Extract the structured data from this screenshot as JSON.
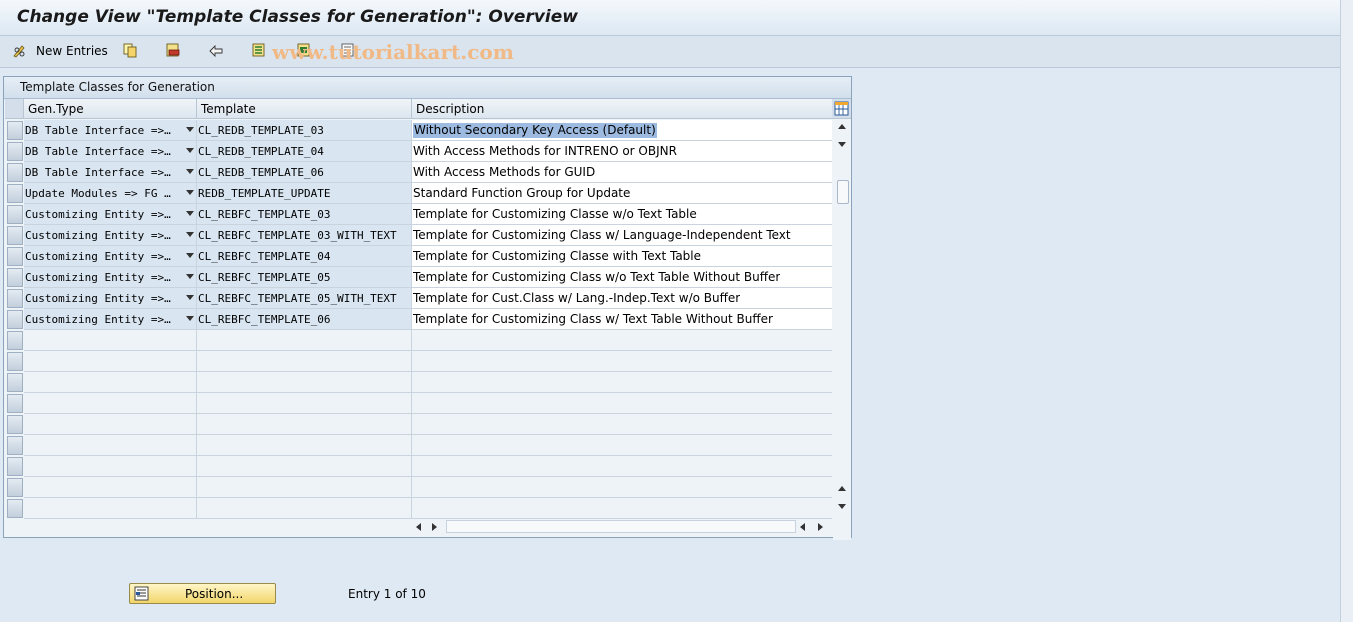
{
  "window": {
    "title": "Change View \"Template Classes for Generation\": Overview"
  },
  "toolbar": {
    "new_entries_label": "New Entries",
    "icons": [
      "pencil-glasses-icon",
      "copy-icon",
      "delete-icon",
      "undo-icon",
      "select-all-icon",
      "select-block-icon",
      "deselect-all-icon"
    ]
  },
  "watermark": "www.tutorialkart.com",
  "table": {
    "title": "Template Classes for Generation",
    "columns": [
      "Gen.Type",
      "Template",
      "Description"
    ],
    "rows": [
      {
        "gen_type": "DB Table Interface =>…",
        "template": "CL_REDB_TEMPLATE_03",
        "description": "Without Secondary Key Access (Default)"
      },
      {
        "gen_type": "DB Table Interface =>…",
        "template": "CL_REDB_TEMPLATE_04",
        "description": "With Access Methods for INTRENO or OBJNR"
      },
      {
        "gen_type": "DB Table Interface =>…",
        "template": "CL_REDB_TEMPLATE_06",
        "description": "With Access Methods for GUID"
      },
      {
        "gen_type": "Update Modules => FG …",
        "template": "REDB_TEMPLATE_UPDATE",
        "description": "Standard Function Group for Update"
      },
      {
        "gen_type": "Customizing Entity =>…",
        "template": "CL_REBFC_TEMPLATE_03",
        "description": "Template for Customizing Classe w/o Text Table"
      },
      {
        "gen_type": "Customizing Entity =>…",
        "template": "CL_REBFC_TEMPLATE_03_WITH_TEXT",
        "description": "Template for Customizing Class w/ Language-Independent Text"
      },
      {
        "gen_type": "Customizing Entity =>…",
        "template": "CL_REBFC_TEMPLATE_04",
        "description": "Template for Customizing Classe with Text Table"
      },
      {
        "gen_type": "Customizing Entity =>…",
        "template": "CL_REBFC_TEMPLATE_05",
        "description": "Template for Customizing Class w/o Text Table Without Buffer"
      },
      {
        "gen_type": "Customizing Entity =>…",
        "template": "CL_REBFC_TEMPLATE_05_WITH_TEXT",
        "description": "Template for Cust.Class w/ Lang.-Indep.Text  w/o Buffer"
      },
      {
        "gen_type": "Customizing Entity =>…",
        "template": "CL_REBFC_TEMPLATE_06",
        "description": "Template for Customizing Class w/ Text Table Without Buffer"
      }
    ],
    "empty_rows": 9,
    "selected_row": 0
  },
  "footer": {
    "position_button_label": "Position...",
    "entry_info": "Entry 1 of 10"
  },
  "colors": {
    "accent": "#f2d66b",
    "selection": "#9dbbe0",
    "watermark": "#f0b985"
  }
}
